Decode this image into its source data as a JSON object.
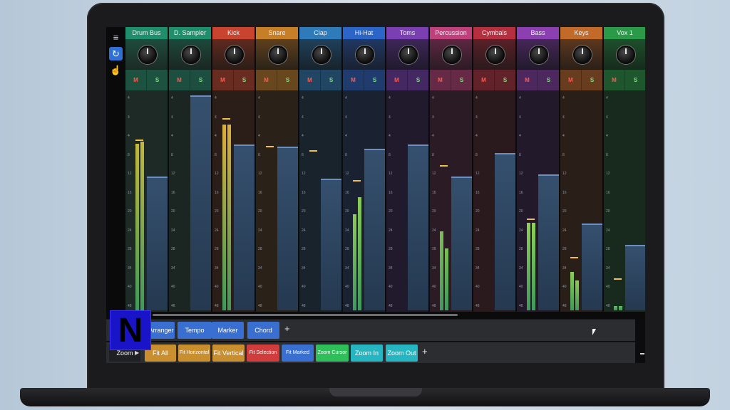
{
  "toolbar": {
    "tools": [
      {
        "name": "mixer-icon",
        "glyph": "≡"
      },
      {
        "name": "loop-icon",
        "glyph": "↻"
      },
      {
        "name": "hand-cursor-icon",
        "glyph": "☝"
      }
    ]
  },
  "channels": [
    {
      "name": "Drum Bus",
      "color": "#1f8f6b",
      "body": "#1d2a26",
      "fader": 0.62,
      "meters": [
        0.78,
        0.79
      ],
      "meter_color": "#c5b73a",
      "peak": 0.79
    },
    {
      "name": "D. Sampler",
      "color": "#1f8f6b",
      "body": "#1b2623",
      "fader": 1.0,
      "meters": [],
      "meter_color": "#c5b73a"
    },
    {
      "name": "Kick",
      "color": "#c8442e",
      "body": "#2b1d18",
      "fader": 0.77,
      "meters": [
        0.87,
        0.87
      ],
      "meter_color": "#dcaf3a",
      "peak": 0.89
    },
    {
      "name": "Snare",
      "color": "#c77f27",
      "body": "#2a2218",
      "fader": 0.76,
      "meters": [],
      "meter_color": "#d8b640",
      "peak_single": 0.76
    },
    {
      "name": "Clap",
      "color": "#2f7ab8",
      "body": "#18232c",
      "fader": 0.61,
      "meters": [],
      "meter_color": "#c5b73a",
      "peak_single": 0.74
    },
    {
      "name": "Hi-Hat",
      "color": "#2a65c7",
      "body": "#1a2131",
      "fader": 0.75,
      "meters": [
        0.45,
        0.53
      ],
      "meter_color": "#8ccc56",
      "peak": 0.6
    },
    {
      "name": "Toms",
      "color": "#7a3fb1",
      "body": "#201a2c",
      "fader": 0.77,
      "meters": [],
      "meter_color": "#c5b73a"
    },
    {
      "name": "Percussion",
      "color": "#c0407c",
      "body": "#2b1b24",
      "fader": 0.62,
      "meters": [
        0.37,
        0.29
      ],
      "meter_color": "#7cbd55",
      "peak_single": 0.67
    },
    {
      "name": "Cymbals",
      "color": "#b62f3e",
      "body": "#2a1a1d",
      "fader": 0.73,
      "meters": [],
      "meter_color": "#c5b73a"
    },
    {
      "name": "Bass",
      "color": "#8b3fb0",
      "body": "#221a2b",
      "fader": 0.63,
      "meters": [
        0.41,
        0.41
      ],
      "meter_color": "#8ed255",
      "peak": 0.42
    },
    {
      "name": "Keys",
      "color": "#c26a2a",
      "body": "#2a1f18",
      "fader": 0.4,
      "meters": [
        0.18,
        0.14
      ],
      "meter_color": "#8ccc56",
      "peak": 0.24
    },
    {
      "name": "Vox 1",
      "color": "#2b9a48",
      "body": "#172a1d",
      "fader": 0.3,
      "meters": [
        0.02,
        0.02
      ],
      "meter_color": "#5dbf5a",
      "peak": 0.14
    }
  ],
  "scale_labels": [
    "4",
    "4",
    "4",
    "8",
    "12",
    "16",
    "20",
    "24",
    "28",
    "34",
    "40",
    "48"
  ],
  "mute_label": "M",
  "solo_label": "S",
  "row1": {
    "buttons": [
      {
        "label": "Arranger",
        "color": "#3a6fd2"
      },
      {
        "label": "Tempo",
        "color": "#3a6fd2"
      },
      {
        "label": "Marker",
        "color": "#3a6fd2"
      },
      {
        "label": "Chord",
        "color": "#3a6fd2"
      }
    ],
    "add": "+"
  },
  "row2": {
    "zoom_label": "Zoom",
    "zoom_arrow": "▶",
    "buttons": [
      {
        "label": "Fit All",
        "color": "#c98f2e",
        "small": false
      },
      {
        "label": "Fit Horizontal",
        "color": "#c98f2e",
        "small": true
      },
      {
        "label": "Fit Vertical",
        "color": "#c98f2e",
        "small": false
      },
      {
        "label": "Fit Selection",
        "color": "#d13c3c",
        "small": true
      },
      {
        "label": "Fit Marked",
        "color": "#3a6fd2",
        "small": true
      },
      {
        "label": "Zoom Cursor",
        "color": "#2fbf5a",
        "small": true
      },
      {
        "label": "Zoom In",
        "color": "#25b6c2",
        "small": false
      },
      {
        "label": "Zoom Out",
        "color": "#25b6c2",
        "small": false
      }
    ],
    "add": "+"
  },
  "logo": {
    "letter": "N"
  }
}
